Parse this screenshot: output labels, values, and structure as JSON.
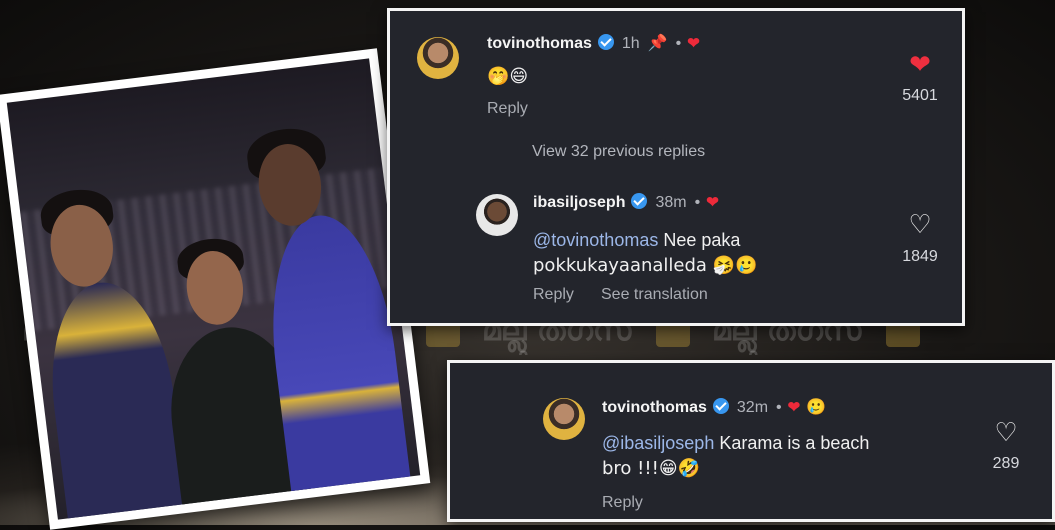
{
  "watermark": {
    "text": "മല്ലു തഗ്സ്"
  },
  "comment1": {
    "username": "tovinothomas",
    "time": "1h",
    "pin_icon": "pin-icon",
    "text": "🤭😄",
    "reply_label": "Reply",
    "likes": "5401",
    "liked": true
  },
  "view_previous": {
    "label": "View 32 previous replies"
  },
  "comment2": {
    "username": "ibasiljoseph",
    "time": "38m",
    "mention": "@tovinothomas",
    "text_after_mention": " Nee paka",
    "text_line2": "pokkukayaanalleda 🤧🥲",
    "reply_label": "Reply",
    "translate_label": "See translation",
    "likes": "1849",
    "liked": false
  },
  "comment3": {
    "username": "tovinothomas",
    "time": "32m",
    "mention": "@ibasiljoseph",
    "text_after_mention": " Karama is a beach",
    "text_line2": "bro !!!😁🤣",
    "reply_label": "Reply",
    "likes": "289",
    "liked": false
  },
  "colors": {
    "panel_bg": "#23252c",
    "heart_red": "#ee2f3f",
    "verified_blue": "#3897f0"
  }
}
